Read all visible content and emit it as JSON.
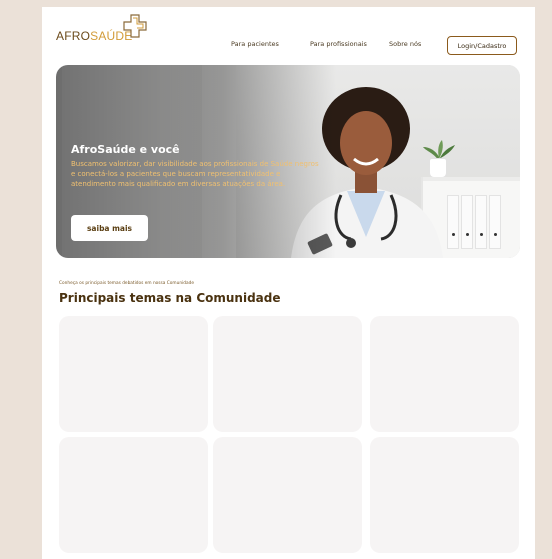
{
  "brand": {
    "afro": "AFRO",
    "saude": "SAÚDE"
  },
  "nav": {
    "items": [
      "Para pacientes",
      "Para profissionais",
      "Sobre nós"
    ],
    "login": "Login/Cadastro"
  },
  "hero": {
    "title": "AfroSaúde e você",
    "text": "Buscamos valorizar, dar visibilidade aos profissionais de Saúde negros e conectá-los a pacientes que buscam representatividade e atendimento mais qualificado em diversas atuações da área.",
    "button": "saiba mais"
  },
  "community": {
    "kicker": "Conheça os principais temas debatidos em nossa Comunidade",
    "title": "Principais temas na Comunidade",
    "cards": 6
  },
  "colors": {
    "page_bg": "#ebe1d8",
    "brand_brown": "#6b4a1a",
    "brand_gold": "#d29b38",
    "card": "#f6f4f4"
  }
}
